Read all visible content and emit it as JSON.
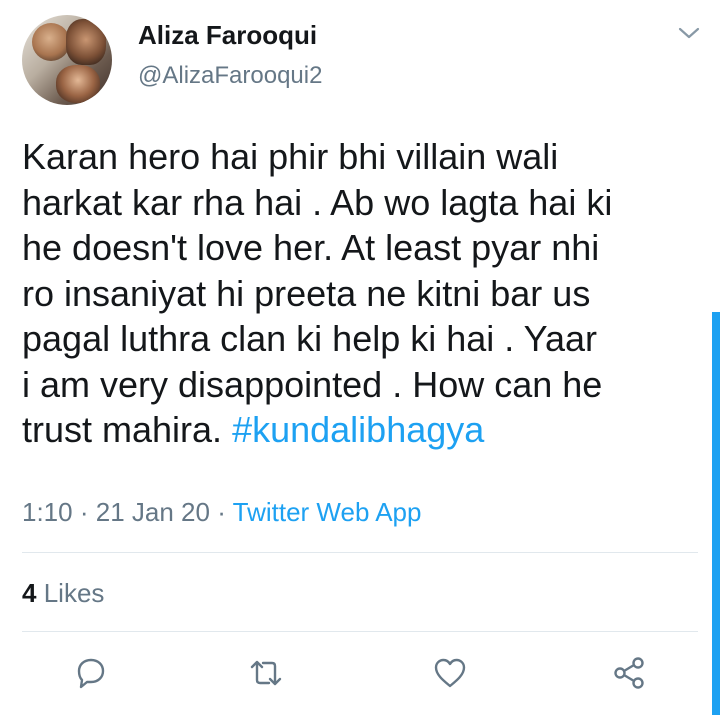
{
  "tweet": {
    "author_name": "Aliza Farooqui",
    "handle": "@AlizaFarooqui2",
    "text_lines": [
      "Karan hero hai phir bhi villain wali",
      "harkat kar rha hai . Ab wo lagta hai ki",
      "he doesn't love her. At least pyar nhi",
      "ro insaniyat hi preeta ne kitni bar us",
      "pagal luthra clan ki help ki hai . Yaar",
      "i am very disappointed . How can he",
      "trust mahira. "
    ],
    "hashtag": "#kundalibhagya",
    "time": "1:10",
    "date": "21 Jan 20",
    "separator": "·",
    "source_app": "Twitter Web App",
    "likes_count": "4",
    "likes_label": "Likes"
  },
  "icons": {
    "menu": "chevron-down-icon",
    "reply": "reply-icon",
    "retweet": "retweet-icon",
    "like": "heart-icon",
    "share": "share-icon"
  },
  "colors": {
    "accent": "#1da1f2",
    "secondary_text": "#657786",
    "primary_text": "#14171a",
    "icon_gray": "#657786"
  }
}
